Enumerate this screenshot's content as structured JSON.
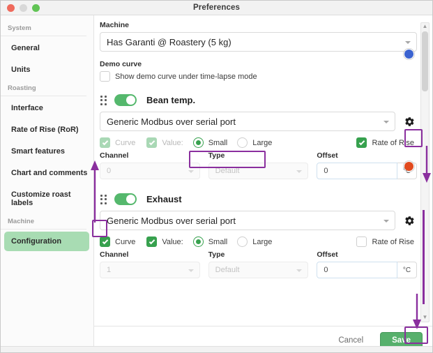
{
  "window": {
    "title": "Preferences",
    "traffic": {
      "close": "close-button",
      "minimize": "minimize-button",
      "zoom": "zoom-button"
    }
  },
  "sidebar": {
    "groups": [
      {
        "label": "System",
        "items": [
          {
            "label": "General",
            "active": false
          },
          {
            "label": "Units",
            "active": false
          }
        ]
      },
      {
        "label": "Roasting",
        "items": [
          {
            "label": "Interface",
            "active": false
          },
          {
            "label": "Rate of Rise (RoR)",
            "active": false
          },
          {
            "label": "Smart features",
            "active": false
          },
          {
            "label": "Chart and comments",
            "active": false
          },
          {
            "label": "Customize roast labels",
            "active": false
          }
        ]
      },
      {
        "label": "Machine",
        "items": [
          {
            "label": "Configuration",
            "active": true
          }
        ]
      }
    ]
  },
  "main": {
    "machine": {
      "label": "Machine",
      "value": "Has Garanti @ Roastery (5 kg)"
    },
    "demo_curve": {
      "label": "Demo curve",
      "checkbox_label": "Show demo curve under time-lapse mode",
      "checked": false
    },
    "devices": [
      {
        "name": "Bean temp.",
        "enabled": true,
        "color": "#3b63d0",
        "color_name": "blue",
        "protocol": "Generic Modbus over serial port",
        "gear_label": "settings-gear",
        "curve": {
          "label": "Curve",
          "checked": true,
          "disabled": true
        },
        "value": {
          "label": "Value:",
          "checked": true,
          "disabled": true
        },
        "size": {
          "options": [
            "Small",
            "Large"
          ],
          "selected": "Small"
        },
        "rate_of_rise": {
          "label": "Rate of Rise",
          "checked": true
        },
        "channel": {
          "label": "Channel",
          "value": "0",
          "disabled": true
        },
        "type": {
          "label": "Type",
          "value": "Default",
          "disabled": true
        },
        "offset": {
          "label": "Offset",
          "value": "0",
          "unit": "°C"
        }
      },
      {
        "name": "Exhaust",
        "enabled": true,
        "color": "#e14a1e",
        "color_name": "red",
        "protocol": "Generic Modbus over serial port",
        "gear_label": "settings-gear",
        "curve": {
          "label": "Curve",
          "checked": true,
          "disabled": false
        },
        "value": {
          "label": "Value:",
          "checked": true,
          "disabled": false
        },
        "size": {
          "options": [
            "Small",
            "Large"
          ],
          "selected": "Small"
        },
        "rate_of_rise": {
          "label": "Rate of Rise",
          "checked": false
        },
        "channel": {
          "label": "Channel",
          "value": "1",
          "disabled": true
        },
        "type": {
          "label": "Type",
          "value": "Default",
          "disabled": true
        },
        "offset": {
          "label": "Offset",
          "value": "0",
          "unit": "°C"
        }
      }
    ]
  },
  "scrollbar": {
    "up": "▲",
    "down": "▼"
  },
  "footer": {
    "cancel": "Cancel",
    "save": "Save"
  },
  "annotations": {
    "color": "#8a2f9e"
  }
}
